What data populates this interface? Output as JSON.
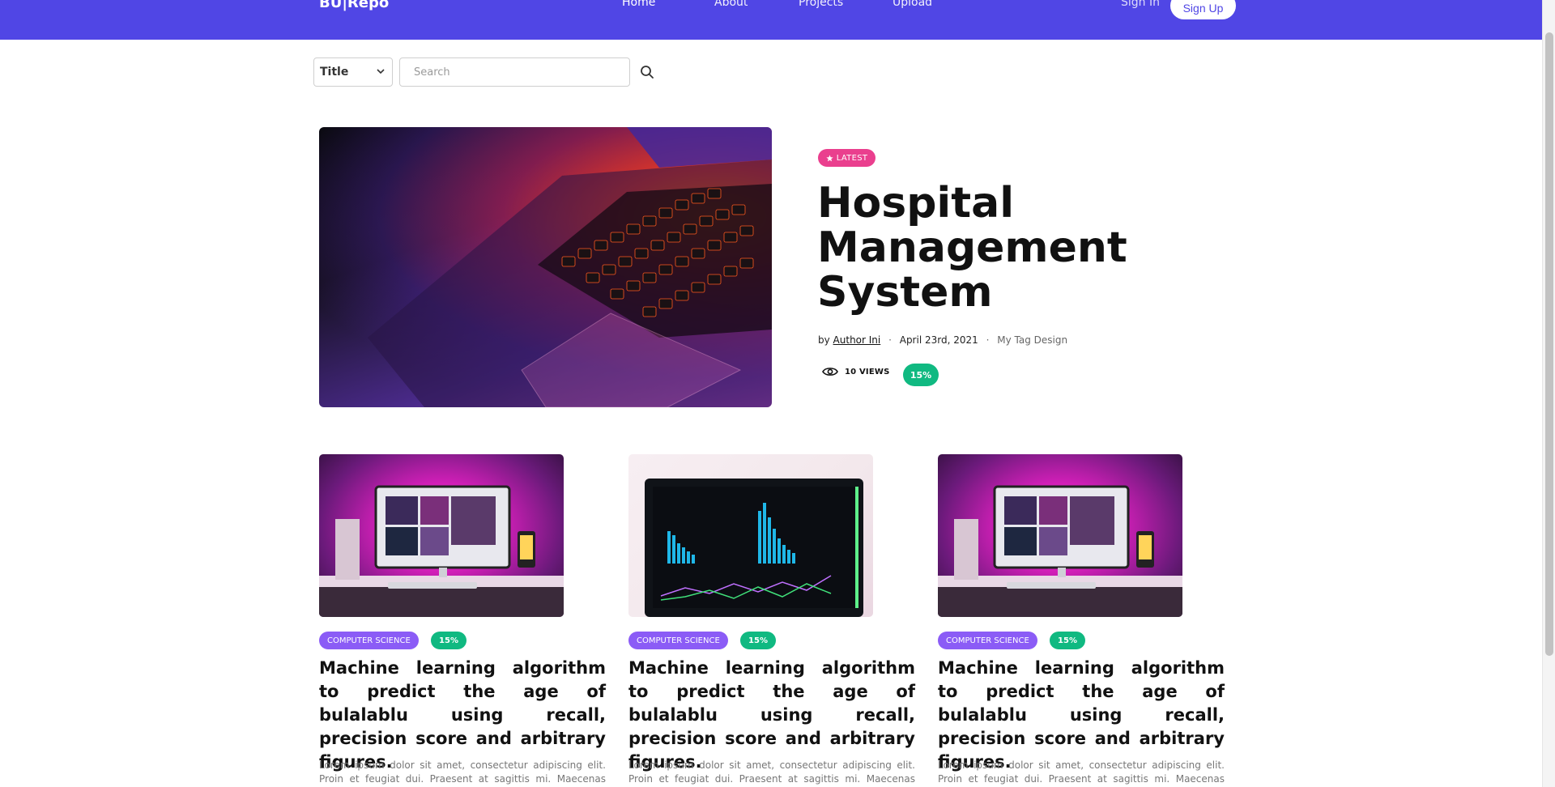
{
  "navbar": {
    "brand": "BU|Repo",
    "links": [
      "Home",
      "About",
      "Projects",
      "Upload"
    ],
    "sign_in": "Sign In",
    "sign_up": "Sign Up"
  },
  "search": {
    "filter_selected": "Title",
    "placeholder": "Search",
    "icon": "search-icon"
  },
  "featured": {
    "badge": "LATEST",
    "badge_icon": "star-icon",
    "title": "Hospital Management System",
    "by_label": "by",
    "author": "Author Ini",
    "date": "April 23rd, 2021",
    "tag": "My Tag Design",
    "views": "10 VIEWS",
    "views_icon": "eye-icon",
    "percent": "15%"
  },
  "projects": [
    {
      "category": "COMPUTER SCIENCE",
      "percent": "15%",
      "title": "Machine learning algorithm to predict the age of bulalablu using recall, precision score and arbitrary figures.",
      "excerpt": "Lorem ipsum dolor sit amet, consectetur adipiscing elit. Proin et feugiat dui. Praesent at sagittis mi. Maecenas bibendum"
    },
    {
      "category": "COMPUTER SCIENCE",
      "percent": "15%",
      "title": "Machine learning algorithm to predict the age of bulalablu using recall, precision score and arbitrary figures.",
      "excerpt": "Lorem ipsum dolor sit amet, consectetur adipiscing elit. Proin et feugiat dui. Praesent at sagittis mi. Maecenas bibendum"
    },
    {
      "category": "COMPUTER SCIENCE",
      "percent": "15%",
      "title": "Machine learning algorithm to predict the age of bulalablu using recall, precision score and arbitrary figures.",
      "excerpt": "Lorem ipsum dolor sit amet, consectetur adipiscing elit. Proin et feugiat dui. Praesent at sagittis mi. Maecenas bibendum"
    }
  ],
  "colors": {
    "navbar": "#5046e5",
    "latest_badge": "#ea3f8e",
    "percent_badge": "#10b981",
    "category_badge": "#8b5cf6"
  }
}
